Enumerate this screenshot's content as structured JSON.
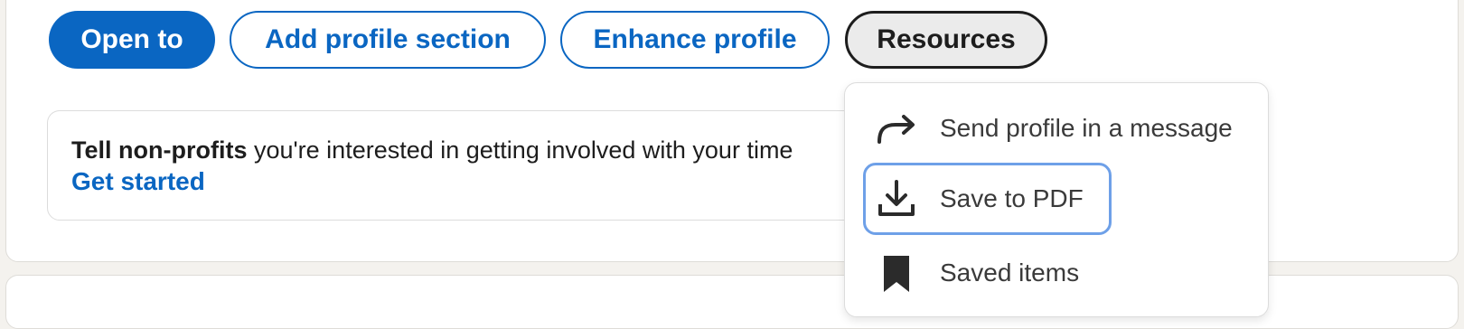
{
  "actions": {
    "open_to": "Open to",
    "add_profile_section": "Add profile section",
    "enhance_profile": "Enhance profile",
    "resources": "Resources"
  },
  "notice": {
    "bold_text": "Tell non-profits",
    "text": " you're interested in getting involved with your time",
    "link": "Get started"
  },
  "resources_menu": {
    "items": [
      {
        "label": "Send profile in a message",
        "icon": "share-arrow-icon"
      },
      {
        "label": "Save to PDF",
        "icon": "download-icon",
        "focused": true
      },
      {
        "label": "Saved items",
        "icon": "bookmark-icon"
      }
    ]
  },
  "colors": {
    "brand_blue": "#0a66c2",
    "focus_ring": "#6ea0e8",
    "page_background": "#f4f2ee"
  }
}
